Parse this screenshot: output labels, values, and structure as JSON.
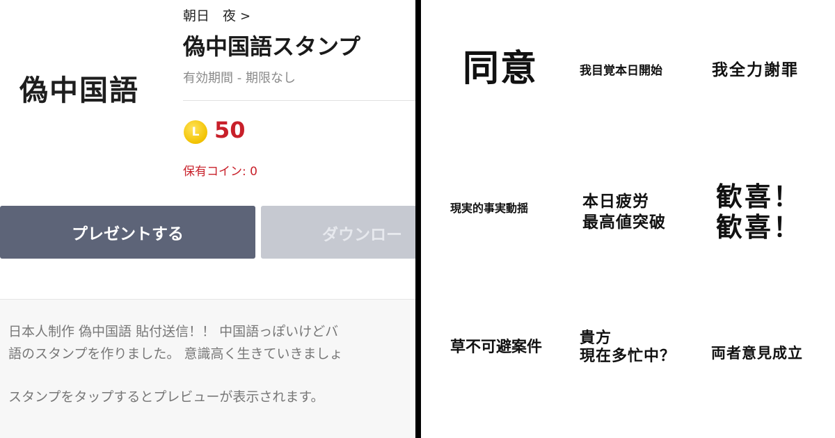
{
  "store": {
    "thumbnail_title": "偽中国語",
    "author": "朝日　夜",
    "author_chevron": ">",
    "pack_title": "偽中国語スタンプ",
    "validity": "有効期間 - 期限なし",
    "coin_symbol": "L",
    "price": "50",
    "owned_coins": "保有コイン: 0",
    "present_button": "プレゼントする",
    "download_button": "ダウンロー",
    "description_line1": "日本人制作 偽中国語 貼付送信！！ 中国語っぽいけどバ",
    "description_line2": "語のスタンプを作りました。 意識高く生きていきましょ",
    "preview_hint": "スタンプをタップするとプレビューが表示されます。"
  },
  "stickers": [
    "同意",
    "我目覚本日開始",
    "我全力謝罪",
    "現実的事実動揺",
    "本日疲労\n最高値突破",
    "歓喜！\n歓喜！",
    "草不可避案件",
    "貴方\n現在多忙中？",
    "両者意見成立"
  ],
  "colors": {
    "price_red": "#c8202a",
    "present_button_bg": "#5d6478",
    "download_button_bg": "#c6c9d1",
    "coin_gold": "#f2c200",
    "divider": "#000000"
  },
  "icons": {
    "coin": "line-coin-icon",
    "chevron": "chevron-right-icon"
  }
}
